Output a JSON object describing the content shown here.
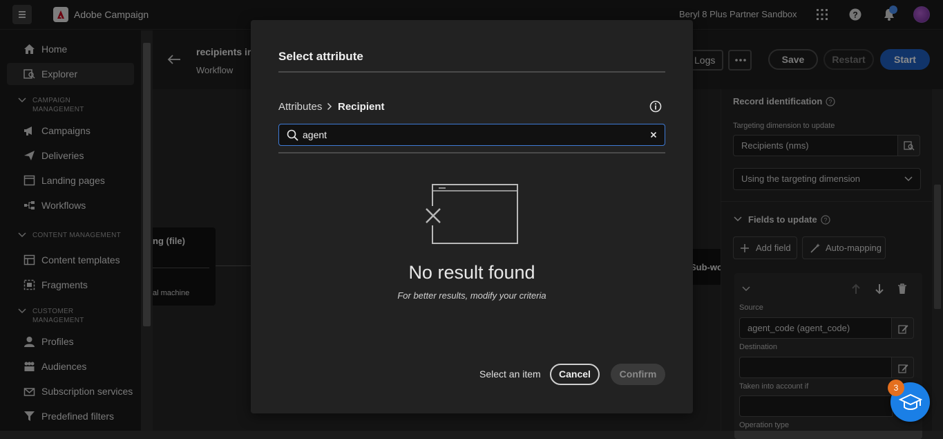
{
  "topbar": {
    "app_name": "Adobe Campaign",
    "org_name": "Beryl 8 Plus Partner Sandbox",
    "icons": [
      "menu-icon",
      "adobe-logo",
      "apps-grid-icon",
      "help-icon",
      "bell-icon",
      "avatar"
    ]
  },
  "leftnav": {
    "items_top": [
      {
        "label": "Home",
        "icon": "home-icon"
      },
      {
        "label": "Explorer",
        "icon": "explorer-icon",
        "active": true
      }
    ],
    "section_campaign": {
      "line1": "CAMPAIGN",
      "line2": "MANAGEMENT"
    },
    "items_campaign": [
      {
        "label": "Campaigns",
        "icon": "megaphone-icon"
      },
      {
        "label": "Deliveries",
        "icon": "send-icon"
      },
      {
        "label": "Landing pages",
        "icon": "page-icon"
      },
      {
        "label": "Workflows",
        "icon": "workflow-icon"
      }
    ],
    "section_content": "CONTENT MANAGEMENT",
    "items_content": [
      {
        "label": "Content templates",
        "icon": "template-icon"
      },
      {
        "label": "Fragments",
        "icon": "fragment-icon"
      }
    ],
    "section_customer": {
      "line1": "CUSTOMER",
      "line2": "MANAGEMENT"
    },
    "items_customer": [
      {
        "label": "Profiles",
        "icon": "user-icon"
      },
      {
        "label": "Audiences",
        "icon": "audience-icon"
      },
      {
        "label": "Subscription services",
        "icon": "subscription-icon"
      },
      {
        "label": "Predefined filters",
        "icon": "filter-icon"
      }
    ]
  },
  "workflow": {
    "title": "recipients ir",
    "subtitle": "Workflow",
    "logs_label": "Logs",
    "save_label": "Save",
    "restart_label": "Restart",
    "start_label": "Start",
    "node_title": "ng (file)",
    "node_sub": "al machine",
    "subwo_label": "Sub-wo"
  },
  "right_panel": {
    "record_heading": "Record identification",
    "targeting_label": "Targeting dimension to update",
    "targeting_value": "Recipients (nms)",
    "using_value": "Using the targeting dimension",
    "fields_heading": "Fields to update",
    "add_field_label": "Add field",
    "auto_mapping_label": "Auto-mapping",
    "source_label": "Source",
    "source_value": "agent_code (agent_code)",
    "destination_label": "Destination",
    "taken_label": "Taken into account if",
    "operation_label": "Operation type"
  },
  "modal": {
    "title": "Select attribute",
    "crumb_root": "Attributes",
    "crumb_current": "Recipient",
    "search_value": "agent",
    "empty_title": "No result found",
    "empty_sub": "For better results, modify your criteria",
    "select_text": "Select an item",
    "cancel_label": "Cancel",
    "confirm_label": "Confirm"
  },
  "learn_badge": "3",
  "colors": {
    "accent": "#1f5fbf",
    "search_border": "#3f7bd6",
    "badge": "#e46f1e"
  }
}
